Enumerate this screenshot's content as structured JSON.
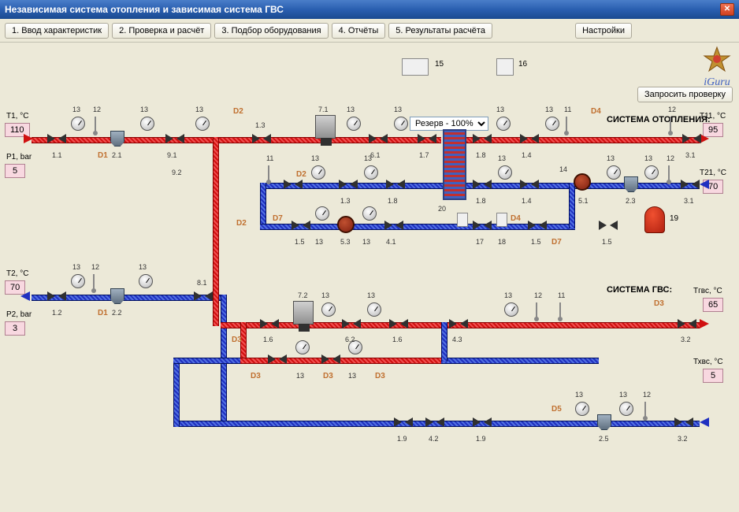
{
  "window": {
    "title": "Независимая система отопления и зависимая система ГВС"
  },
  "toolbar": {
    "b1": "1. Ввод характеристик",
    "b2": "2. Проверка и расчёт",
    "b3": "3. Подбор оборудования",
    "b4": "4. Отчёты",
    "b5": "5. Результаты расчёта",
    "settings": "Настройки"
  },
  "logo": {
    "text": "iGuru"
  },
  "request_btn": "Запросить проверку",
  "dropdown": {
    "label": "Резерв - 100%",
    "options": [
      "Резерв - 100%"
    ]
  },
  "sections": {
    "heating": "СИСТЕМА ОТОПЛЕНИЯ:",
    "hws": "СИСТЕМА ГВС:"
  },
  "inputs_left": {
    "t1_label": "T1, °C",
    "t1": "110",
    "p1_label": "P1, bar",
    "p1": "5",
    "t2_label": "T2, °C",
    "t2": "70",
    "p2_label": "P2, bar",
    "p2": "3"
  },
  "inputs_right": {
    "t11_label": "T11, °C",
    "t11": "95",
    "t21_label": "T21, °C",
    "t21": "70",
    "thws_label": "Тгвс, °C",
    "thws": "65",
    "tcws_label": "Тхвс, °C",
    "tcws": "5"
  },
  "groups": {
    "d1a": "D1",
    "d1b": "D1",
    "d2a": "D2",
    "d2b": "D2",
    "d2c": "D2",
    "d3a": "D3",
    "d3b": "D3",
    "d3c": "D3",
    "d3d": "D3",
    "d3e": "D3",
    "d4a": "D4",
    "d4b": "D4",
    "d5": "D5",
    "d7a": "D7",
    "d7b": "D7"
  },
  "labels": {
    "n11": "11",
    "n12": "12",
    "n13": "13",
    "n14": "14",
    "n15": "15",
    "n16": "16",
    "n17": "17",
    "n18": "18",
    "n19": "19",
    "n20": "20",
    "p1_1": "1.1",
    "p1_2": "1.2",
    "p1_3": "1.3",
    "p1_4": "1.4",
    "p1_5": "1.5",
    "p1_6": "1.6",
    "p1_7": "1.7",
    "p1_8": "1.8",
    "p1_9": "1.9",
    "p2_1": "2.1",
    "p2_2": "2.2",
    "p2_3": "2.3",
    "p2_5": "2.5",
    "p3_1": "3.1",
    "p3_2": "3.2",
    "p4_1": "4.1",
    "p4_2": "4.2",
    "p4_3": "4.3",
    "p5_1": "5.1",
    "p5_3": "5.3",
    "p6_1": "6.1",
    "p6_2": "6.2",
    "p7_1": "7.1",
    "p7_2": "7.2",
    "p8_1": "8.1",
    "p9_1": "9.1",
    "p9_2": "9.2"
  }
}
